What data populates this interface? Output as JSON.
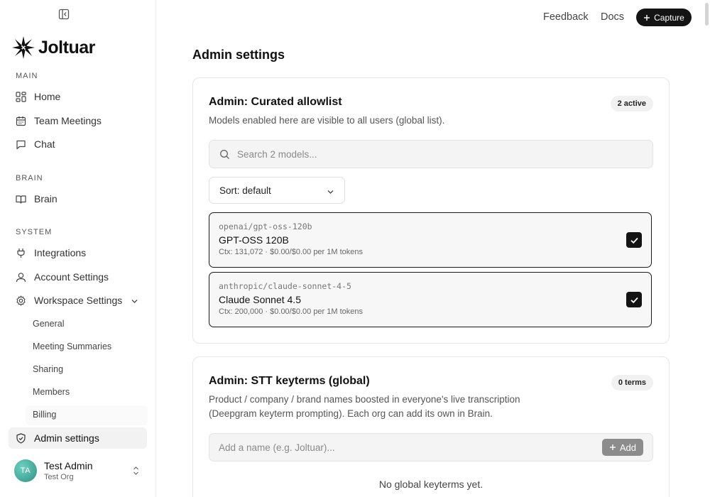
{
  "sidebar": {
    "logo_text": "Joltuar",
    "sections": {
      "main": "MAIN",
      "brain": "BRAIN",
      "system": "SYSTEM"
    },
    "items": {
      "home": "Home",
      "team_meetings": "Team Meetings",
      "chat": "Chat",
      "brain": "Brain",
      "integrations": "Integrations",
      "account_settings": "Account Settings",
      "workspace_settings": "Workspace Settings",
      "admin_settings": "Admin settings"
    },
    "workspace_sub": {
      "general": "General",
      "meeting_summaries": "Meeting Summaries",
      "sharing": "Sharing",
      "members": "Members",
      "billing": "Billing"
    },
    "user": {
      "initials": "TA",
      "name": "Test Admin",
      "org": "Test Org"
    }
  },
  "topbar": {
    "feedback": "Feedback",
    "docs": "Docs",
    "capture": "Capture"
  },
  "main": {
    "title": "Admin settings",
    "allowlist": {
      "title": "Admin: Curated allowlist",
      "badge": "2 active",
      "description": "Models enabled here are visible to all users (global list).",
      "search_placeholder": "Search 2 models...",
      "sort_label": "Sort: default",
      "models": [
        {
          "id": "openai/gpt-oss-120b",
          "name": "GPT-OSS 120B",
          "meta": "Ctx: 131,072 · $0.00/$0.00 per 1M tokens",
          "checked": true
        },
        {
          "id": "anthropic/claude-sonnet-4-5",
          "name": "Claude Sonnet 4.5",
          "meta": "Ctx: 200,000 · $0.00/$0.00 per 1M tokens",
          "checked": true
        }
      ]
    },
    "keyterms": {
      "title": "Admin: STT keyterms (global)",
      "badge": "0 terms",
      "description_line1": "Product / company / brand names boosted in everyone's live transcription",
      "description_line2": "(Deepgram keyterm prompting). Each org can add its own in Brain.",
      "input_placeholder": "Add a name (e.g. Joltuar)...",
      "add_label": "Add",
      "empty_text": "No global keyterms yet."
    }
  }
}
